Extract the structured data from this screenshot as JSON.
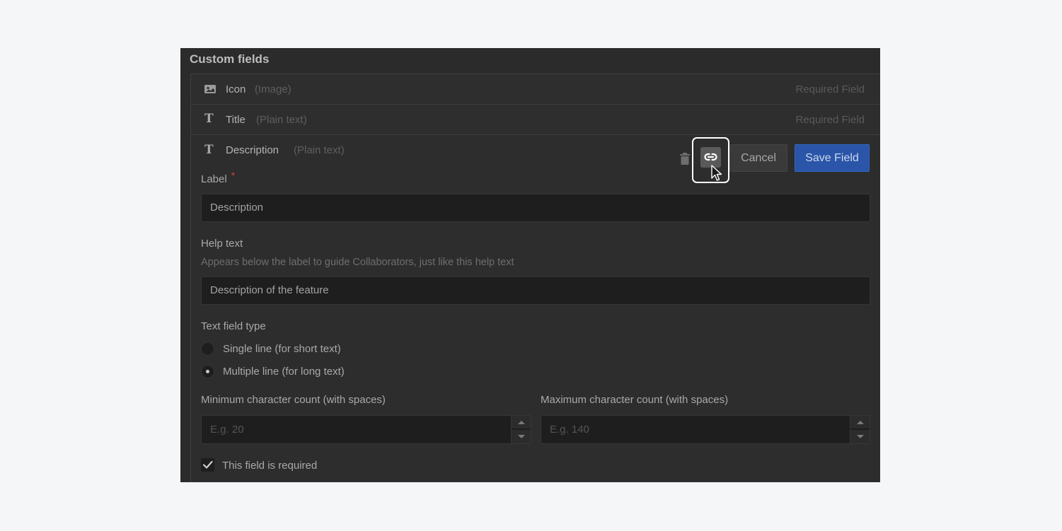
{
  "section_title": "Custom fields",
  "fields": [
    {
      "name": "Icon",
      "type": "(Image)",
      "required": "Required Field",
      "icon": "image-icon"
    },
    {
      "name": "Title",
      "type": "(Plain text)",
      "required": "Required Field",
      "icon": "text-type-icon"
    },
    {
      "name": "Description",
      "type": "(Plain text)",
      "icon": "text-type-icon"
    }
  ],
  "actions": {
    "delete_icon": "trash-icon",
    "link_icon": "link-icon",
    "cancel_label": "Cancel",
    "save_label": "Save Field"
  },
  "form": {
    "label_title": "Label",
    "label_required_marker": "*",
    "label_value": "Description",
    "help_title": "Help text",
    "help_description": "Appears below the label to guide Collaborators, just like this help text",
    "help_value": "Description of the feature",
    "text_type_title": "Text field type",
    "text_type_options": [
      {
        "label": "Single line (for short text)",
        "selected": false
      },
      {
        "label": "Multiple line (for long text)",
        "selected": true
      }
    ],
    "min_title": "Minimum character count (with spaces)",
    "min_placeholder": "E.g. 20",
    "max_title": "Maximum character count (with spaces)",
    "max_placeholder": "E.g. 140",
    "required_checkbox_label": "This field is required",
    "required_checked": true
  },
  "colors": {
    "panel_bg": "#2b2b2b",
    "save_button": "#2a55a8",
    "required_star": "#c84343"
  }
}
